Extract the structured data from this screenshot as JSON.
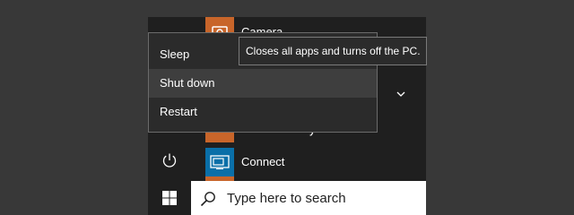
{
  "start_menu": {
    "apps": {
      "camera": "Camera",
      "partial": "y",
      "connect": "Connect"
    }
  },
  "power_menu": {
    "items": [
      {
        "label": "Sleep"
      },
      {
        "label": "Shut down"
      },
      {
        "label": "Restart"
      }
    ]
  },
  "tooltip": {
    "text": "Closes all apps and turns off the PC."
  },
  "taskbar": {
    "search_placeholder": "Type here to search"
  },
  "icons": {
    "power": "power-icon",
    "windows": "windows-logo-icon",
    "search": "search-icon",
    "chevron": "chevron-down-icon",
    "connect": "connect-icon",
    "camera": "camera-icon"
  },
  "colors": {
    "desktop": "#383838",
    "menu_bg": "#1f1f1f",
    "power_menu_bg": "#2b2b2b",
    "highlight": "#3e3e3e",
    "tile_orange": "#c8652a",
    "tile_blue": "#0a6fa8"
  }
}
